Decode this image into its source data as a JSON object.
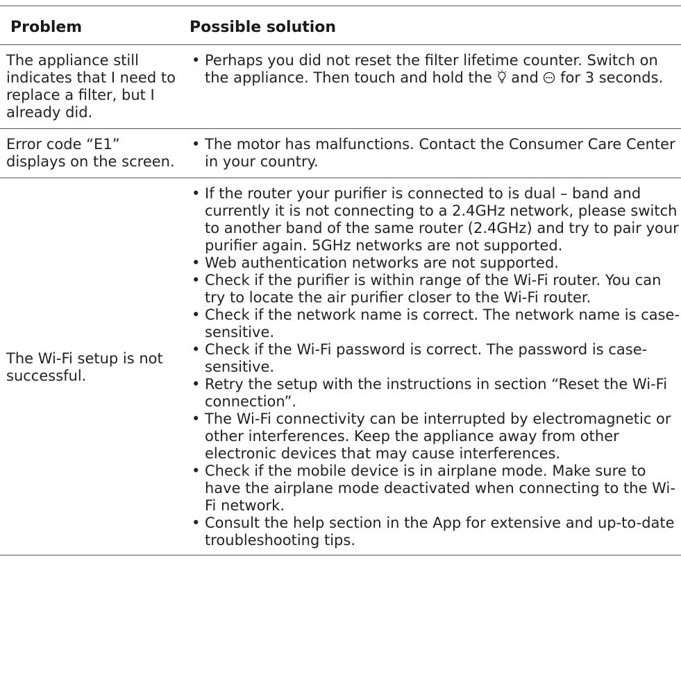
{
  "table": {
    "header": {
      "problem": "Problem",
      "solution": "Possible solution"
    },
    "rows": [
      {
        "problem": "The appliance still indicates that I need to replace a filter, but I already did.",
        "solutions": [
          {
            "before": "Perhaps you did not reset the filter lifetime counter. Switch on the appliance. Then touch and hold the ",
            "icon1": "light-bulb-icon",
            "middle": " and ",
            "icon2": "mode-icon",
            "after": "  for 3 seconds."
          }
        ]
      },
      {
        "problem": "Error code “E1” displays on the screen.",
        "solutions": [
          "The motor has malfunctions. Contact the Consumer Care Center in your country."
        ]
      },
      {
        "problem": "The Wi-Fi setup is not successful.",
        "solutions": [
          "If the router your purifier is connected to is dual – band and currently it is not connecting to a 2.4GHz network, please switch to another band of the same router (2.4GHz) and try to pair your purifier again. 5GHz networks are not supported.",
          "Web authentication networks are not supported.",
          "Check if the purifier is within range of the Wi-Fi router. You can try to locate the air purifier closer to the Wi-Fi router.",
          "Check if the network name is correct. The network name is case-sensitive.",
          "Check if the Wi-Fi password is correct. The password is case-sensitive.",
          "Retry the setup with the instructions in section “Reset the Wi-Fi connection”.",
          "The Wi-Fi connectivity can be interrupted by electromagnetic or other interferences. Keep the appliance away from other electronic devices that may cause interferences.",
          "Check if the mobile device is in airplane mode. Make sure to have the airplane mode deactivated when connecting to the Wi-Fi network.",
          "Consult the help section in the App for extensive and up-to-date troubleshooting tips."
        ]
      }
    ]
  }
}
